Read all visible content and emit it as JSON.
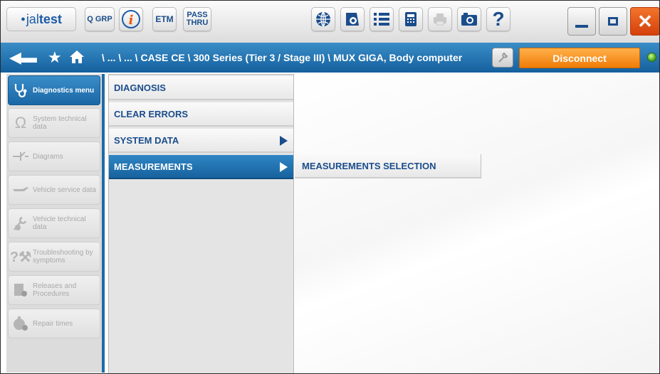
{
  "toolbar": {
    "logo": {
      "dot": "●",
      "brand_light": "jal",
      "brand_bold": "test"
    },
    "grp_label": "Q GRP",
    "info_icon": "info-icon",
    "etm_label": "ETM",
    "pass_thru": {
      "line1": "PASS",
      "line2": "THRU"
    },
    "icons": [
      "globe-icon",
      "eye-icon",
      "list-icon",
      "calculator-icon",
      "printer-icon",
      "camera-icon",
      "help-icon"
    ],
    "help_label": "?",
    "window": {
      "minimize": "minimize-icon",
      "maximize": "maximize-icon",
      "close_label": "✕"
    }
  },
  "navbar": {
    "breadcrumb": "\\ ... \\ ... \\ CASE CE \\ 300 Series (Tier 3 / Stage III) \\ MUX GIGA, Body computer",
    "disconnect_label": "Disconnect",
    "status_color": "#4caf23"
  },
  "sidebar": {
    "items": [
      {
        "label": "Diagnostics menu",
        "icon": "stethoscope-icon",
        "active": true
      },
      {
        "label": "System technical data",
        "icon": "ohm-icon",
        "active": false
      },
      {
        "label": "Diagrams",
        "icon": "diagram-icon",
        "active": false
      },
      {
        "label": "Vehicle service data",
        "icon": "oil-can-icon",
        "active": false
      },
      {
        "label": "Vehicle technical data",
        "icon": "wrench-gear-icon",
        "active": false
      },
      {
        "label": "Troubleshooting by symptoms",
        "icon": "troubleshoot-icon",
        "active": false
      },
      {
        "label": "Releases and Procedures",
        "icon": "procedures-icon",
        "active": false
      },
      {
        "label": "Repair times",
        "icon": "stopwatch-icon",
        "active": false
      }
    ]
  },
  "menu": {
    "items": [
      {
        "label": "DIAGNOSIS",
        "has_submenu": false,
        "selected": false
      },
      {
        "label": "CLEAR ERRORS",
        "has_submenu": false,
        "selected": false
      },
      {
        "label": "SYSTEM DATA",
        "has_submenu": true,
        "selected": false
      },
      {
        "label": "MEASUREMENTS",
        "has_submenu": true,
        "selected": true
      }
    ]
  },
  "submenu": {
    "items": [
      {
        "label": "MEASUREMENTS SELECTION"
      }
    ]
  },
  "colors": {
    "accent": "#1f6aa8",
    "disconnect": "#f28a14",
    "close": "#e2531a",
    "menu_text": "#1b4d8c"
  }
}
